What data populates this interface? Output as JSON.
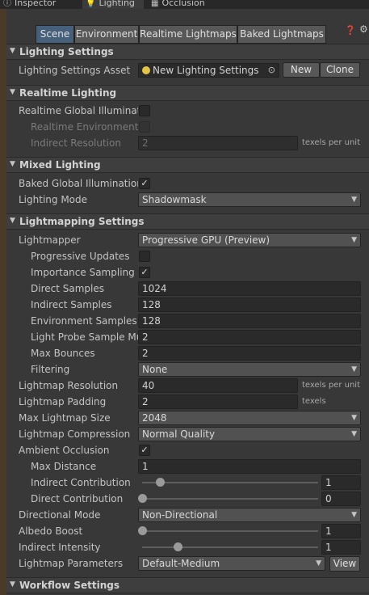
{
  "tabs": [
    {
      "label": "Inspector",
      "icon": "info-icon"
    },
    {
      "label": "Lighting",
      "icon": "bulb-icon"
    },
    {
      "label": "Occlusion",
      "icon": "occlusion-icon"
    }
  ],
  "subtabs": [
    "Scene",
    "Environment",
    "Realtime Lightmaps",
    "Baked Lightmaps"
  ],
  "sections": {
    "lighting_settings": "Lighting Settings",
    "realtime_lighting": "Realtime Lighting",
    "mixed_lighting": "Mixed Lighting",
    "lightmapping_settings": "Lightmapping Settings",
    "workflow_settings": "Workflow Settings"
  },
  "lighting_settings": {
    "asset_label": "Lighting Settings Asset",
    "asset_value": "New Lighting Settings",
    "new_button": "New",
    "clone_button": "Clone"
  },
  "realtime": {
    "gi_label": "Realtime Global Illuminatio",
    "env_label": "Realtime Environment L",
    "indirect_res_label": "Indirect Resolution",
    "indirect_res_value": "2",
    "indirect_res_unit": "texels per unit",
    "gi_checked": false,
    "env_checked": false
  },
  "mixed": {
    "baked_gi_label": "Baked Global Illumination",
    "baked_gi_checked": true,
    "mode_label": "Lighting Mode",
    "mode_value": "Shadowmask"
  },
  "lightmapping": {
    "lightmapper_label": "Lightmapper",
    "lightmapper_value": "Progressive GPU (Preview)",
    "progressive_updates_label": "Progressive Updates",
    "progressive_updates_checked": false,
    "importance_sampling_label": "Importance Sampling",
    "importance_sampling_checked": true,
    "direct_samples_label": "Direct Samples",
    "direct_samples_value": "1024",
    "indirect_samples_label": "Indirect Samples",
    "indirect_samples_value": "128",
    "environment_samples_label": "Environment Samples",
    "environment_samples_value": "128",
    "light_probe_label": "Light Probe Sample Mu",
    "light_probe_value": "2",
    "max_bounces_label": "Max Bounces",
    "max_bounces_value": "2",
    "filtering_label": "Filtering",
    "filtering_value": "None",
    "resolution_label": "Lightmap Resolution",
    "resolution_value": "40",
    "resolution_unit": "texels per unit",
    "padding_label": "Lightmap Padding",
    "padding_value": "2",
    "padding_unit": "texels",
    "max_size_label": "Max Lightmap Size",
    "max_size_value": "2048",
    "compression_label": "Lightmap Compression",
    "compression_value": "Normal Quality",
    "ao_label": "Ambient Occlusion",
    "ao_checked": true,
    "max_distance_label": "Max Distance",
    "max_distance_value": "1",
    "indirect_contribution_label": "Indirect Contribution",
    "indirect_contribution_value": "1",
    "indirect_contribution_fraction": 0.1,
    "direct_contribution_label": "Direct Contribution",
    "direct_contribution_value": "0",
    "direct_contribution_fraction": 0.0,
    "directional_mode_label": "Directional Mode",
    "directional_mode_value": "Non-Directional",
    "albedo_boost_label": "Albedo Boost",
    "albedo_boost_value": "1",
    "albedo_boost_fraction": 0.0,
    "indirect_intensity_label": "Indirect Intensity",
    "indirect_intensity_value": "1",
    "indirect_intensity_fraction": 0.2,
    "parameters_label": "Lightmap Parameters",
    "parameters_value": "Default-Medium",
    "view_button": "View"
  },
  "icons": {
    "check": "✓",
    "dropdown": "▼",
    "expanded": "▼",
    "help": "❓",
    "gear": "⚙",
    "picker": "⊙"
  },
  "colors": {
    "selected_tab": "#46607c",
    "panel_bg": "#383838",
    "field_bg": "#2a2a2a"
  }
}
